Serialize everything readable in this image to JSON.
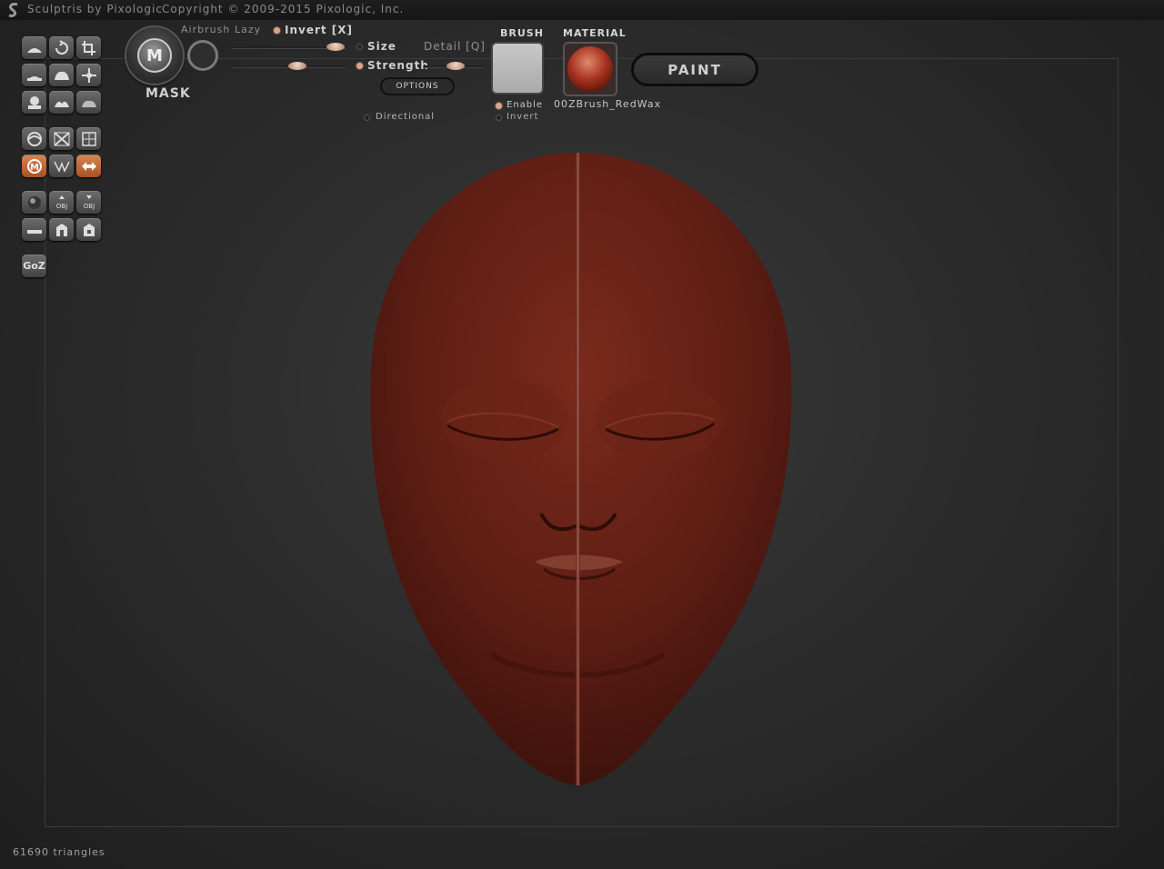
{
  "title_bar": {
    "app_title": "Sculptris by Pixologic",
    "copyright": "Copyright © 2009-2015 Pixologic, Inc."
  },
  "mask": {
    "label": "MASK",
    "icon_glyph": "M"
  },
  "top_options": {
    "airbrush": "Airbrush",
    "lazy": "Lazy",
    "invert": "Invert [X]",
    "size": "Size",
    "detail": "Detail [Q]",
    "strength": "Strength",
    "options_button": "OPTIONS",
    "directional": "Directional"
  },
  "brush": {
    "title": "BRUSH",
    "enable": "Enable",
    "invert": "Invert"
  },
  "material": {
    "title": "MATERIAL",
    "name": "00ZBrush_RedWax"
  },
  "paint_button": "PAINT",
  "goz_label": "GoZ",
  "obj_label": "OBJ",
  "status": {
    "triangles": "61690 triangles"
  },
  "colors": {
    "accent": "#c46a35",
    "material_red": "#8a3020",
    "background": "#2c2c2c"
  },
  "sliders": {
    "size_level": 0.85,
    "strength_level": 0.55,
    "detail_level": 0.6
  },
  "toggles": {
    "invert_on": true,
    "size_on": false,
    "strength_on": true,
    "directional_on": false,
    "brush_enable_on": true,
    "brush_invert_on": false
  }
}
